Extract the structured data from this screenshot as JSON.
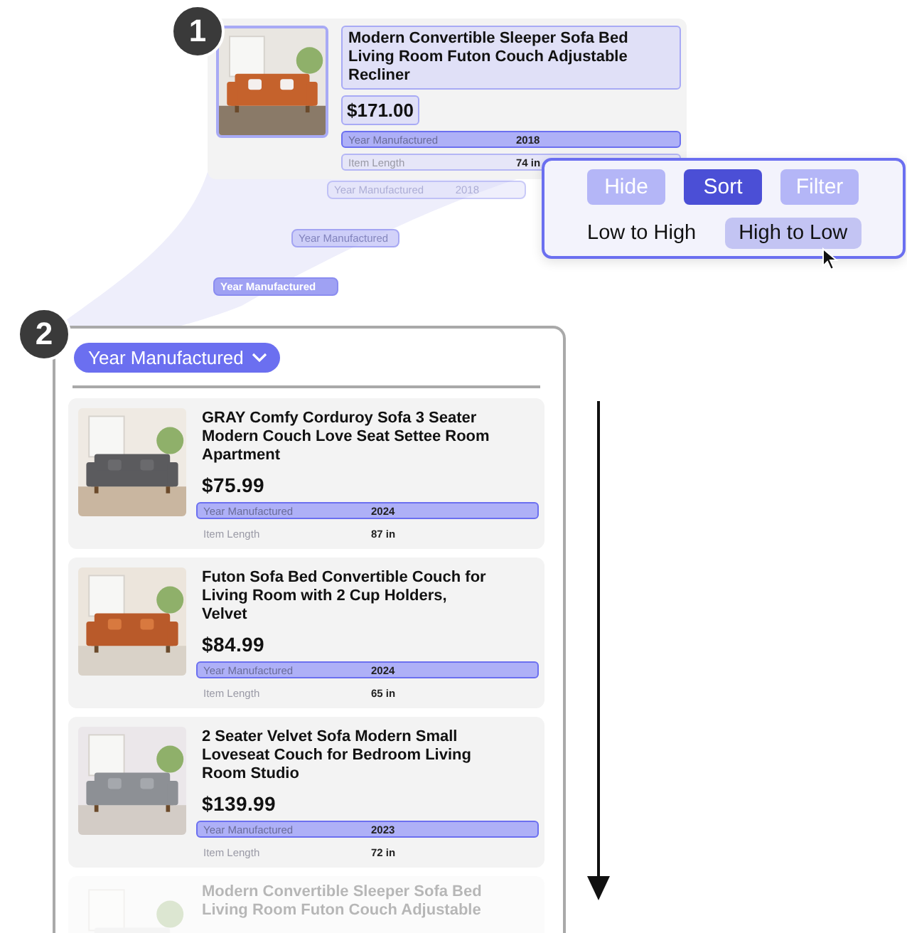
{
  "steps": [
    {
      "number": "1"
    },
    {
      "number": "2"
    }
  ],
  "featured_product": {
    "image": {
      "kind": "picture"
    },
    "title": "Modern Convertible Sleeper Sofa Bed Living Room Futon Couch Adjustable Recliner",
    "price": "$171.00",
    "specs": [
      {
        "label": "Year Manufactured",
        "value": "2018",
        "highlighted": true
      },
      {
        "label": "Item Length",
        "value": "74 in",
        "highlighted": false
      }
    ]
  },
  "floating_chips": [
    {
      "label": "Year Manufactured",
      "value": "2018"
    },
    {
      "label": "Year Manufactured"
    },
    {
      "label": "Year Manufactured"
    }
  ],
  "sort_menu": {
    "tabs": [
      {
        "label": "Hide",
        "selected": false
      },
      {
        "label": "Sort",
        "selected": true
      },
      {
        "label": "Filter",
        "selected": false
      }
    ],
    "options": [
      {
        "label": "Low to High",
        "selected": false
      },
      {
        "label": "High to Low",
        "selected": true
      }
    ]
  },
  "panel": {
    "sort_field": "Year Manufactured",
    "products": [
      {
        "image": {
          "kind": "picture"
        },
        "title": "GRAY Comfy Corduroy Sofa 3 Seater Modern Couch Love Seat Settee Room Apartment",
        "price": "$75.99",
        "faded": false,
        "specs": [
          {
            "label": "Year Manufactured",
            "value": "2024",
            "highlighted": true
          },
          {
            "label": "Item Length",
            "value": "87 in",
            "highlighted": false
          }
        ]
      },
      {
        "image": {
          "kind": "picture"
        },
        "title": "Futon Sofa Bed Convertible Couch for Living Room with 2 Cup Holders, Velvet",
        "price": "$84.99",
        "faded": false,
        "specs": [
          {
            "label": "Year Manufactured",
            "value": "2024",
            "highlighted": true
          },
          {
            "label": "Item Length",
            "value": "65 in",
            "highlighted": false
          }
        ]
      },
      {
        "image": {
          "kind": "picture"
        },
        "title": "2 Seater Velvet Sofa Modern Small Loveseat Couch for Bedroom Living Room Studio",
        "price": "$139.99",
        "faded": false,
        "specs": [
          {
            "label": "Year Manufactured",
            "value": "2023",
            "highlighted": true
          },
          {
            "label": "Item Length",
            "value": "72 in",
            "highlighted": false
          }
        ]
      },
      {
        "image": {
          "kind": "picture"
        },
        "title": "Modern Convertible Sleeper Sofa Bed Living Room Futon Couch Adjustable",
        "faded": true
      }
    ]
  }
}
